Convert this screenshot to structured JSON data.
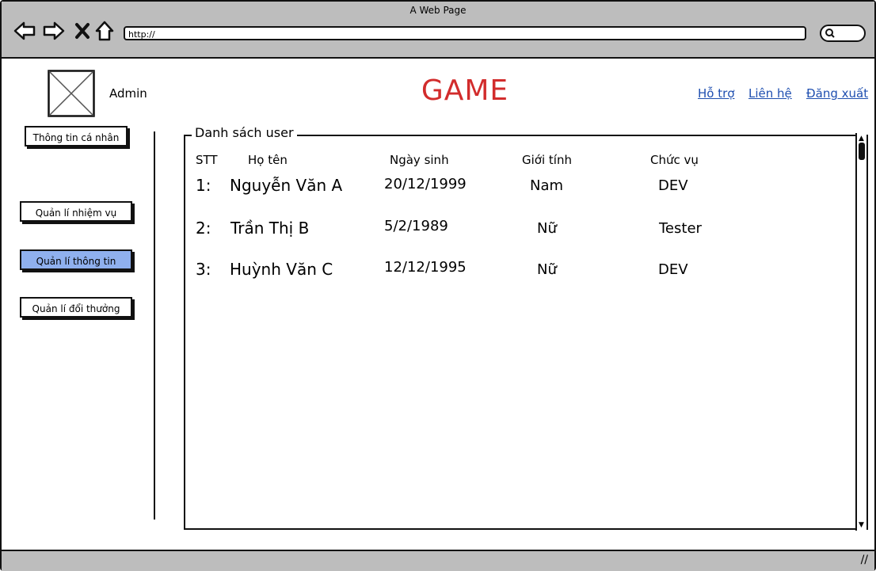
{
  "window": {
    "title": "A Web Page"
  },
  "browser": {
    "url": "http://",
    "icons": [
      "back-arrow-icon",
      "forward-arrow-icon",
      "close-x-icon",
      "home-icon",
      "search-icon"
    ]
  },
  "header": {
    "username": "Admin",
    "app_title": "GAME",
    "links": {
      "support": "Hỗ trợ",
      "contact": "Liên hệ",
      "logout": "Đăng xuất"
    }
  },
  "sidebar": {
    "items": [
      {
        "label": "Thông tin cá nhân",
        "active": false
      },
      {
        "label": "Quản lí nhiệm vụ",
        "active": false
      },
      {
        "label": "Quản lí thông tin",
        "active": true
      },
      {
        "label": "Quản lí đổi thưởng",
        "active": false
      }
    ]
  },
  "panel": {
    "title": "Danh sách user",
    "columns": [
      "STT",
      "Họ tên",
      "Ngày sinh",
      "Giới tính",
      "Chức vụ"
    ],
    "rows": [
      {
        "stt": "1:",
        "name": "Nguyễn Văn A",
        "dob": "20/12/1999",
        "gender": "Nam",
        "role": "DEV"
      },
      {
        "stt": "2:",
        "name": "Trần Thị B",
        "dob": "5/2/1989",
        "gender": "Nữ",
        "role": "Tester"
      },
      {
        "stt": "3:",
        "name": "Huỳnh Văn C",
        "dob": "12/12/1995",
        "gender": "Nữ",
        "role": "DEV"
      }
    ]
  },
  "colors": {
    "title_red": "#d22c2c",
    "link_blue": "#1f4fb0",
    "active_item": "#8fb0ee",
    "chrome_gray": "#bdbdbd"
  }
}
